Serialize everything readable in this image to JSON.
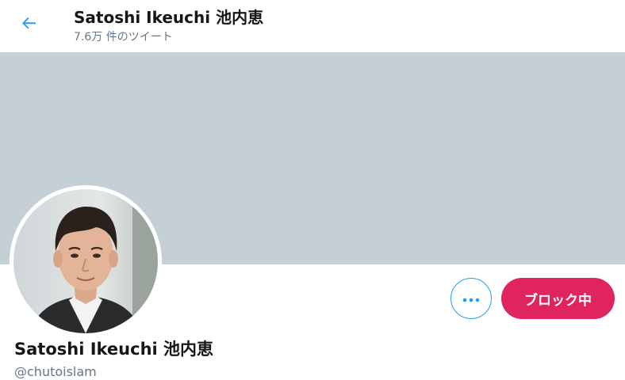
{
  "header": {
    "back_icon": "arrow-left-icon",
    "title": "Satoshi Ikeuchi 池内恵",
    "tweet_count": "7.6万 件のツイート"
  },
  "banner": {
    "color": "#c4cfd6"
  },
  "profile": {
    "name": "Satoshi Ikeuchi 池内恵",
    "handle": "@chutoislam",
    "more_icon": "more-horizontal-icon",
    "block_button_label": "ブロック中"
  },
  "colors": {
    "accent": "#1da1f2",
    "block": "#e0245e",
    "secondary_text": "#657786"
  }
}
